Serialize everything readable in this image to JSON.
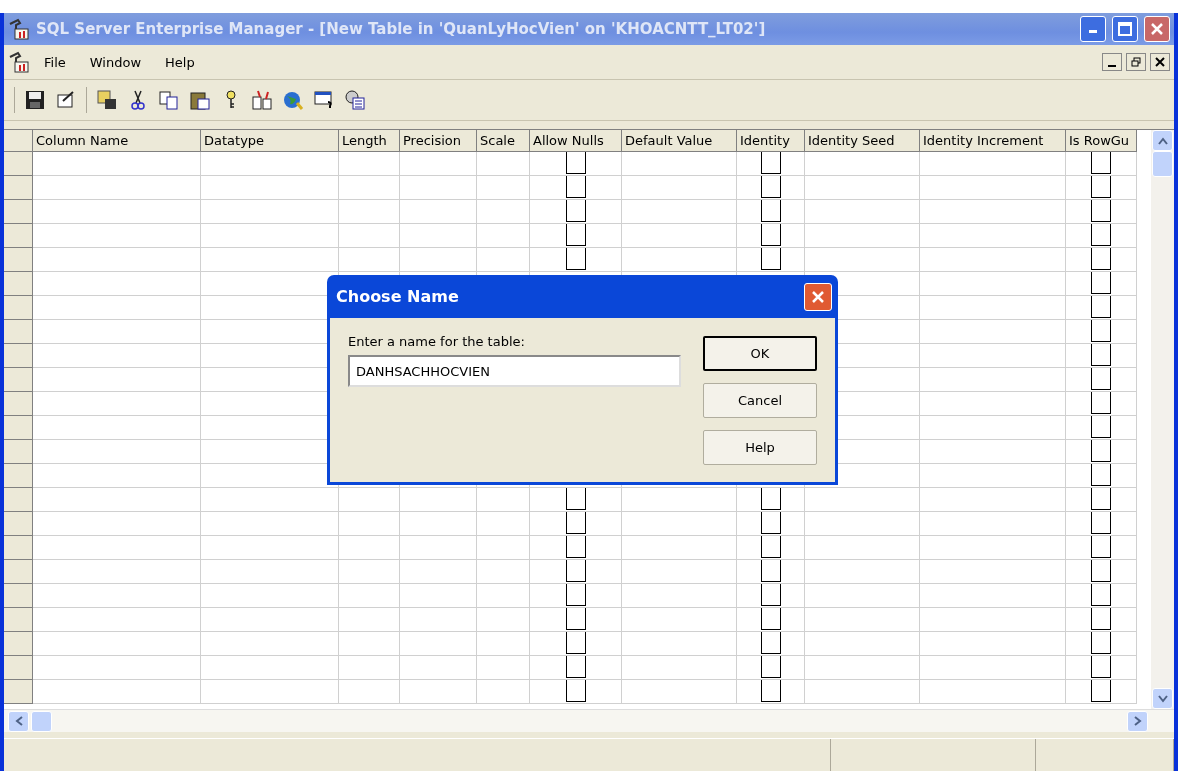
{
  "window": {
    "title": "SQL Server Enterprise Manager - [New Table in 'QuanLyHocVien' on 'KHOACNTT_LT02']"
  },
  "menu": [
    "File",
    "Window",
    "Help"
  ],
  "table": {
    "columns": [
      {
        "label": "Column Name",
        "kind": "text"
      },
      {
        "label": "Datatype",
        "kind": "text"
      },
      {
        "label": "Length",
        "kind": "text"
      },
      {
        "label": "Precision",
        "kind": "text"
      },
      {
        "label": "Scale",
        "kind": "text"
      },
      {
        "label": "Allow Nulls",
        "kind": "check"
      },
      {
        "label": "Default Value",
        "kind": "text"
      },
      {
        "label": "Identity",
        "kind": "check"
      },
      {
        "label": "Identity Seed",
        "kind": "text"
      },
      {
        "label": "Identity Increment",
        "kind": "text"
      },
      {
        "label": "Is RowGu",
        "kind": "check"
      }
    ],
    "rows": [
      {
        "allow_nulls": false,
        "identity": false,
        "is_rowgu": false
      },
      {
        "allow_nulls": false,
        "identity": false,
        "is_rowgu": false
      },
      {
        "allow_nulls": false,
        "identity": false,
        "is_rowgu": false
      },
      {
        "allow_nulls": false,
        "identity": false,
        "is_rowgu": false
      },
      {
        "allow_nulls": false,
        "identity": false,
        "is_rowgu": false
      },
      {
        "is_rowgu": false
      },
      {
        "is_rowgu": false
      },
      {
        "is_rowgu": false
      },
      {
        "is_rowgu": false
      },
      {
        "is_rowgu": false
      },
      {
        "is_rowgu": false
      },
      {
        "is_rowgu": false
      },
      {
        "is_rowgu": false
      },
      {
        "is_rowgu": false
      },
      {
        "allow_nulls": false,
        "identity": false,
        "is_rowgu": false
      },
      {
        "allow_nulls": false,
        "identity": false,
        "is_rowgu": false
      },
      {
        "allow_nulls": false,
        "identity": false,
        "is_rowgu": false
      },
      {
        "allow_nulls": false,
        "identity": false,
        "is_rowgu": false
      },
      {
        "allow_nulls": false,
        "identity": false,
        "is_rowgu": false
      },
      {
        "allow_nulls": false,
        "identity": false,
        "is_rowgu": false
      },
      {
        "allow_nulls": false,
        "identity": false,
        "is_rowgu": false
      },
      {
        "allow_nulls": false,
        "identity": false,
        "is_rowgu": false
      },
      {
        "allow_nulls": false,
        "identity": false,
        "is_rowgu": false
      }
    ]
  },
  "dialog": {
    "title": "Choose Name",
    "label": "Enter a name for the table:",
    "value": "DANHSACHHOCVIEN",
    "buttons": [
      "OK",
      "Cancel",
      "Help"
    ]
  }
}
